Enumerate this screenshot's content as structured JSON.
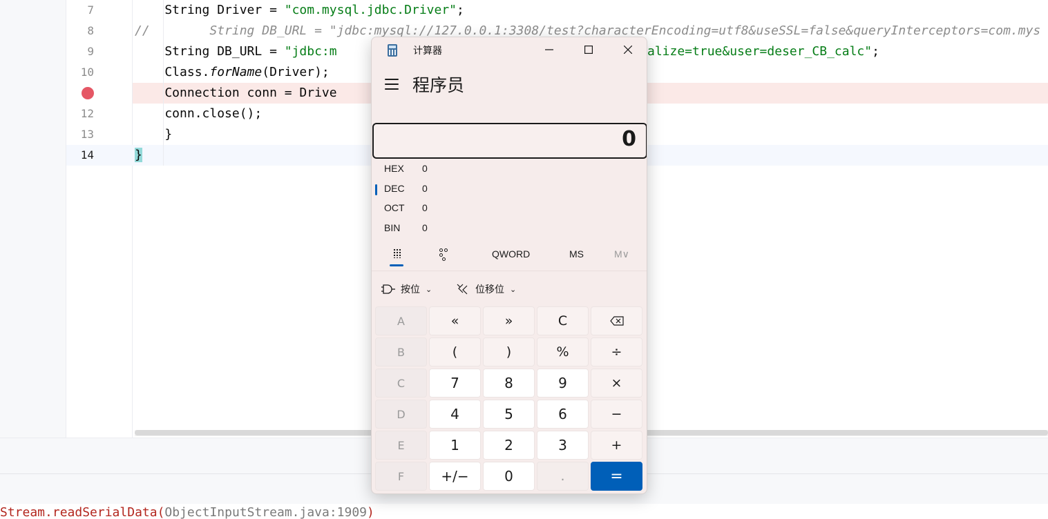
{
  "editor": {
    "lines": [
      {
        "no": "7"
      },
      {
        "no": "8"
      },
      {
        "no": "9"
      },
      {
        "no": "10"
      },
      {
        "no": "",
        "breakpoint": true
      },
      {
        "no": "12"
      },
      {
        "no": "13"
      },
      {
        "no": "14",
        "current": true
      }
    ],
    "code": {
      "l7_prefix": "    String Driver = ",
      "l7_str": "\"com.mysql.jdbc.Driver\"",
      "l7_suffix": ";",
      "l8": "//        String DB_URL = \"jdbc:mysql://127.0.0.1:3308/test?characterEncoding=utf8&useSSL=false&queryInterceptors=com.mys",
      "l9_prefix": "    String DB_URL = ",
      "l9_str_a": "\"jdbc:m",
      "l9_str_b": "alize=true&user=deser_CB_calc\"",
      "l9_suffix": ";",
      "l10_prefix": "    Class.",
      "l10_method": "forName",
      "l10_suffix": "(Driver);",
      "l11": "    Connection conn = Drive",
      "l12": "    conn.close();",
      "l13": "    }",
      "l14": "}"
    },
    "breakpoint_color": "#e55765"
  },
  "console": {
    "stack_text": "Stream.readSerialData(",
    "stack_location": "ObjectInputStream.java:1909",
    "stack_close": ")"
  },
  "calculator": {
    "window_title": "计算器",
    "mode": "程序员",
    "display_value": "0",
    "radix": [
      {
        "name": "HEX",
        "value": "0",
        "selected": false
      },
      {
        "name": "DEC",
        "value": "0",
        "selected": true
      },
      {
        "name": "OCT",
        "value": "0",
        "selected": false
      },
      {
        "name": "BIN",
        "value": "0",
        "selected": false
      }
    ],
    "toolbar": {
      "word_size": "QWORD",
      "memory_store": "MS",
      "memory_recall": "M∨"
    },
    "ops": {
      "bitwise": "按位",
      "bitshift": "位移位"
    },
    "keys": [
      [
        "A",
        "«",
        "»",
        "C",
        "⌫"
      ],
      [
        "B",
        "(",
        ")",
        "%",
        "÷"
      ],
      [
        "C",
        "7",
        "8",
        "9",
        "×"
      ],
      [
        "D",
        "4",
        "5",
        "6",
        "−"
      ],
      [
        "E",
        "1",
        "2",
        "3",
        "+"
      ],
      [
        "F",
        "+/−",
        "0",
        ".",
        "="
      ]
    ],
    "accent_color": "#005fb8"
  }
}
